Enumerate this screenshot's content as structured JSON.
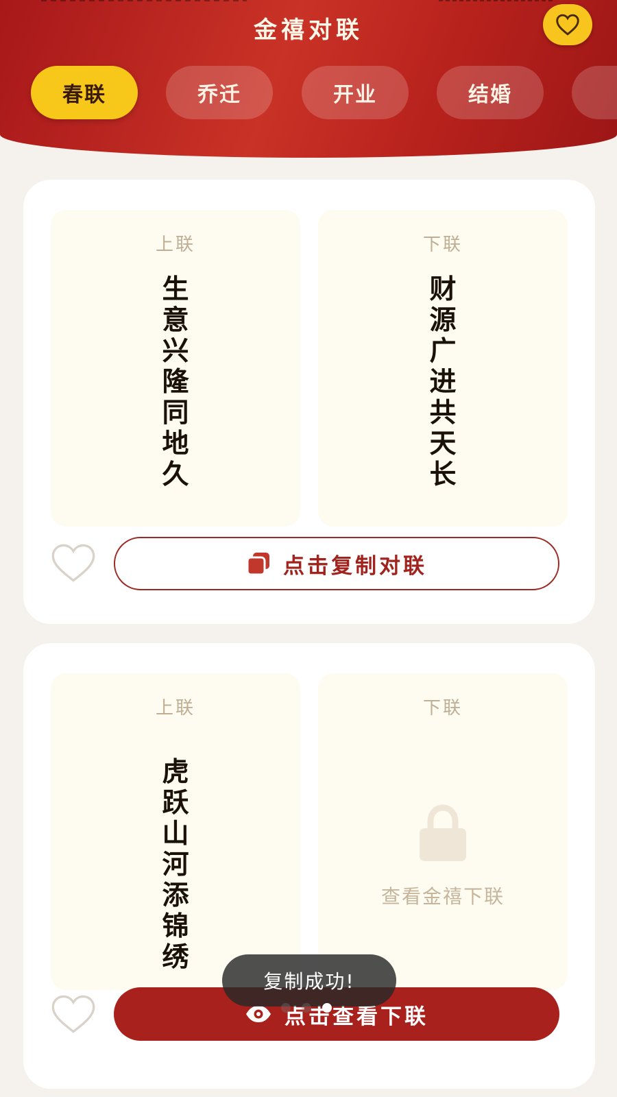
{
  "header": {
    "title": "金禧对联",
    "favorites_icon": "heart-icon"
  },
  "tabs": [
    {
      "label": "春联",
      "active": true
    },
    {
      "label": "乔迁",
      "active": false
    },
    {
      "label": "开业",
      "active": false
    },
    {
      "label": "结婚",
      "active": false
    },
    {
      "label": "",
      "active": false
    }
  ],
  "cards": [
    {
      "upper": {
        "label": "上联",
        "chars": [
          "生",
          "意",
          "兴",
          "隆",
          "同",
          "地",
          "久"
        ]
      },
      "lower": {
        "label": "下联",
        "chars": [
          "财",
          "源",
          "广",
          "进",
          "共",
          "天",
          "长"
        ],
        "locked": false
      },
      "favorite_icon": "heart-outline-icon",
      "action": {
        "label": "点击复制对联",
        "icon": "copy-icon"
      }
    },
    {
      "upper": {
        "label": "上联",
        "chars": [
          "虎",
          "跃",
          "山",
          "河",
          "添",
          "锦",
          "绣"
        ]
      },
      "lower": {
        "label": "下联",
        "locked": true,
        "lock_text": "查看金禧下联",
        "icon": "lock-icon"
      },
      "favorite_icon": "heart-outline-icon",
      "action": {
        "label": "点击查看下联",
        "icon": "eye-icon"
      }
    }
  ],
  "toast": {
    "text": "复制成功!"
  },
  "pager": {
    "count": 3,
    "active_index": 2
  },
  "colors": {
    "header_red": "#b8221d",
    "tab_active_yellow": "#f7c81a",
    "button_red": "#a8211c",
    "couplet_bg": "#fefcf1",
    "label_tan": "#bfae93"
  }
}
